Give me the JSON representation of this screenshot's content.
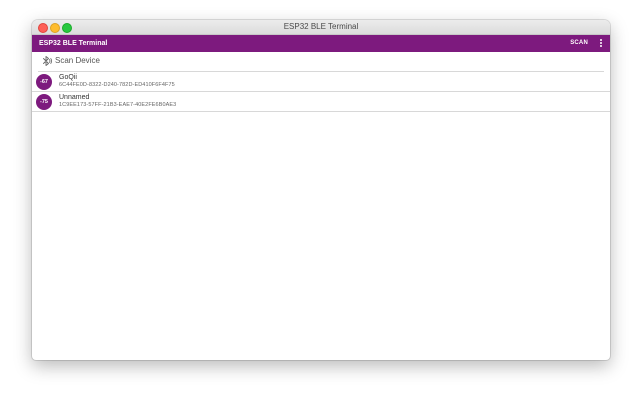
{
  "window": {
    "title": "ESP32 BLE Terminal"
  },
  "appbar": {
    "title": "ESP32 BLE Terminal",
    "scan_label": "SCAN",
    "menu_icon": "more-vert-icon"
  },
  "scan_section": {
    "icon": "bluetooth-searching-icon",
    "label": "Scan Device"
  },
  "devices": [
    {
      "rssi": "-67",
      "name": "GoQii",
      "uuid": "6C44FE0D-8322-D240-782D-ED410F6F4F75"
    },
    {
      "rssi": "-75",
      "name": "Unnamed",
      "uuid": "1C9EE173-57FF-21B3-EAE7-40E2FE6B0AE3"
    }
  ],
  "colors": {
    "accent": "#7d1a7e",
    "window_bg": "#ffffff",
    "divider": "#d8d8d8"
  }
}
